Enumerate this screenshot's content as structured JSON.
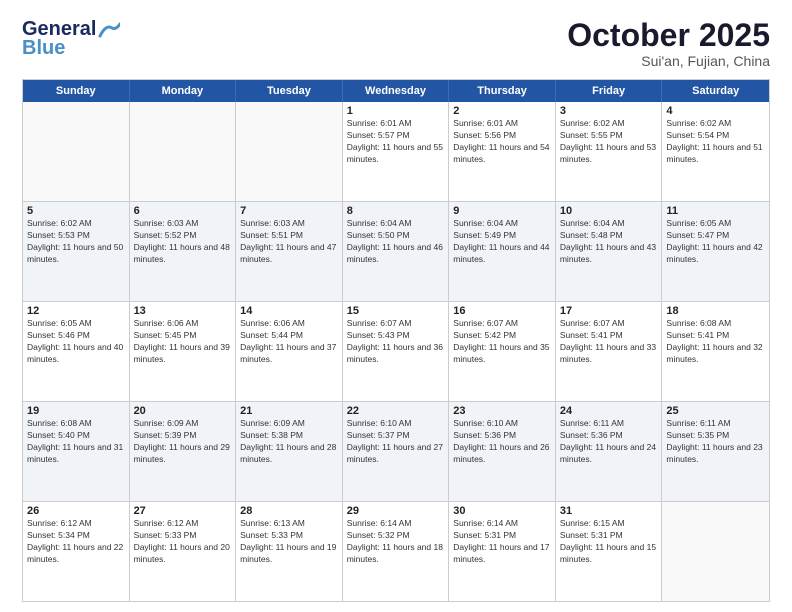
{
  "header": {
    "logo_general": "General",
    "logo_blue": "Blue",
    "month_title": "October 2025",
    "location": "Sui'an, Fujian, China"
  },
  "calendar": {
    "days_of_week": [
      "Sunday",
      "Monday",
      "Tuesday",
      "Wednesday",
      "Thursday",
      "Friday",
      "Saturday"
    ],
    "rows": [
      [
        {
          "day": "",
          "empty": true
        },
        {
          "day": "",
          "empty": true
        },
        {
          "day": "",
          "empty": true
        },
        {
          "day": "1",
          "sunrise": "6:01 AM",
          "sunset": "5:57 PM",
          "daylight": "11 hours and 55 minutes."
        },
        {
          "day": "2",
          "sunrise": "6:01 AM",
          "sunset": "5:56 PM",
          "daylight": "11 hours and 54 minutes."
        },
        {
          "day": "3",
          "sunrise": "6:02 AM",
          "sunset": "5:55 PM",
          "daylight": "11 hours and 53 minutes."
        },
        {
          "day": "4",
          "sunrise": "6:02 AM",
          "sunset": "5:54 PM",
          "daylight": "11 hours and 51 minutes."
        }
      ],
      [
        {
          "day": "5",
          "sunrise": "6:02 AM",
          "sunset": "5:53 PM",
          "daylight": "11 hours and 50 minutes."
        },
        {
          "day": "6",
          "sunrise": "6:03 AM",
          "sunset": "5:52 PM",
          "daylight": "11 hours and 48 minutes."
        },
        {
          "day": "7",
          "sunrise": "6:03 AM",
          "sunset": "5:51 PM",
          "daylight": "11 hours and 47 minutes."
        },
        {
          "day": "8",
          "sunrise": "6:04 AM",
          "sunset": "5:50 PM",
          "daylight": "11 hours and 46 minutes."
        },
        {
          "day": "9",
          "sunrise": "6:04 AM",
          "sunset": "5:49 PM",
          "daylight": "11 hours and 44 minutes."
        },
        {
          "day": "10",
          "sunrise": "6:04 AM",
          "sunset": "5:48 PM",
          "daylight": "11 hours and 43 minutes."
        },
        {
          "day": "11",
          "sunrise": "6:05 AM",
          "sunset": "5:47 PM",
          "daylight": "11 hours and 42 minutes."
        }
      ],
      [
        {
          "day": "12",
          "sunrise": "6:05 AM",
          "sunset": "5:46 PM",
          "daylight": "11 hours and 40 minutes."
        },
        {
          "day": "13",
          "sunrise": "6:06 AM",
          "sunset": "5:45 PM",
          "daylight": "11 hours and 39 minutes."
        },
        {
          "day": "14",
          "sunrise": "6:06 AM",
          "sunset": "5:44 PM",
          "daylight": "11 hours and 37 minutes."
        },
        {
          "day": "15",
          "sunrise": "6:07 AM",
          "sunset": "5:43 PM",
          "daylight": "11 hours and 36 minutes."
        },
        {
          "day": "16",
          "sunrise": "6:07 AM",
          "sunset": "5:42 PM",
          "daylight": "11 hours and 35 minutes."
        },
        {
          "day": "17",
          "sunrise": "6:07 AM",
          "sunset": "5:41 PM",
          "daylight": "11 hours and 33 minutes."
        },
        {
          "day": "18",
          "sunrise": "6:08 AM",
          "sunset": "5:41 PM",
          "daylight": "11 hours and 32 minutes."
        }
      ],
      [
        {
          "day": "19",
          "sunrise": "6:08 AM",
          "sunset": "5:40 PM",
          "daylight": "11 hours and 31 minutes."
        },
        {
          "day": "20",
          "sunrise": "6:09 AM",
          "sunset": "5:39 PM",
          "daylight": "11 hours and 29 minutes."
        },
        {
          "day": "21",
          "sunrise": "6:09 AM",
          "sunset": "5:38 PM",
          "daylight": "11 hours and 28 minutes."
        },
        {
          "day": "22",
          "sunrise": "6:10 AM",
          "sunset": "5:37 PM",
          "daylight": "11 hours and 27 minutes."
        },
        {
          "day": "23",
          "sunrise": "6:10 AM",
          "sunset": "5:36 PM",
          "daylight": "11 hours and 26 minutes."
        },
        {
          "day": "24",
          "sunrise": "6:11 AM",
          "sunset": "5:36 PM",
          "daylight": "11 hours and 24 minutes."
        },
        {
          "day": "25",
          "sunrise": "6:11 AM",
          "sunset": "5:35 PM",
          "daylight": "11 hours and 23 minutes."
        }
      ],
      [
        {
          "day": "26",
          "sunrise": "6:12 AM",
          "sunset": "5:34 PM",
          "daylight": "11 hours and 22 minutes."
        },
        {
          "day": "27",
          "sunrise": "6:12 AM",
          "sunset": "5:33 PM",
          "daylight": "11 hours and 20 minutes."
        },
        {
          "day": "28",
          "sunrise": "6:13 AM",
          "sunset": "5:33 PM",
          "daylight": "11 hours and 19 minutes."
        },
        {
          "day": "29",
          "sunrise": "6:14 AM",
          "sunset": "5:32 PM",
          "daylight": "11 hours and 18 minutes."
        },
        {
          "day": "30",
          "sunrise": "6:14 AM",
          "sunset": "5:31 PM",
          "daylight": "11 hours and 17 minutes."
        },
        {
          "day": "31",
          "sunrise": "6:15 AM",
          "sunset": "5:31 PM",
          "daylight": "11 hours and 15 minutes."
        },
        {
          "day": "",
          "empty": true
        }
      ]
    ]
  }
}
